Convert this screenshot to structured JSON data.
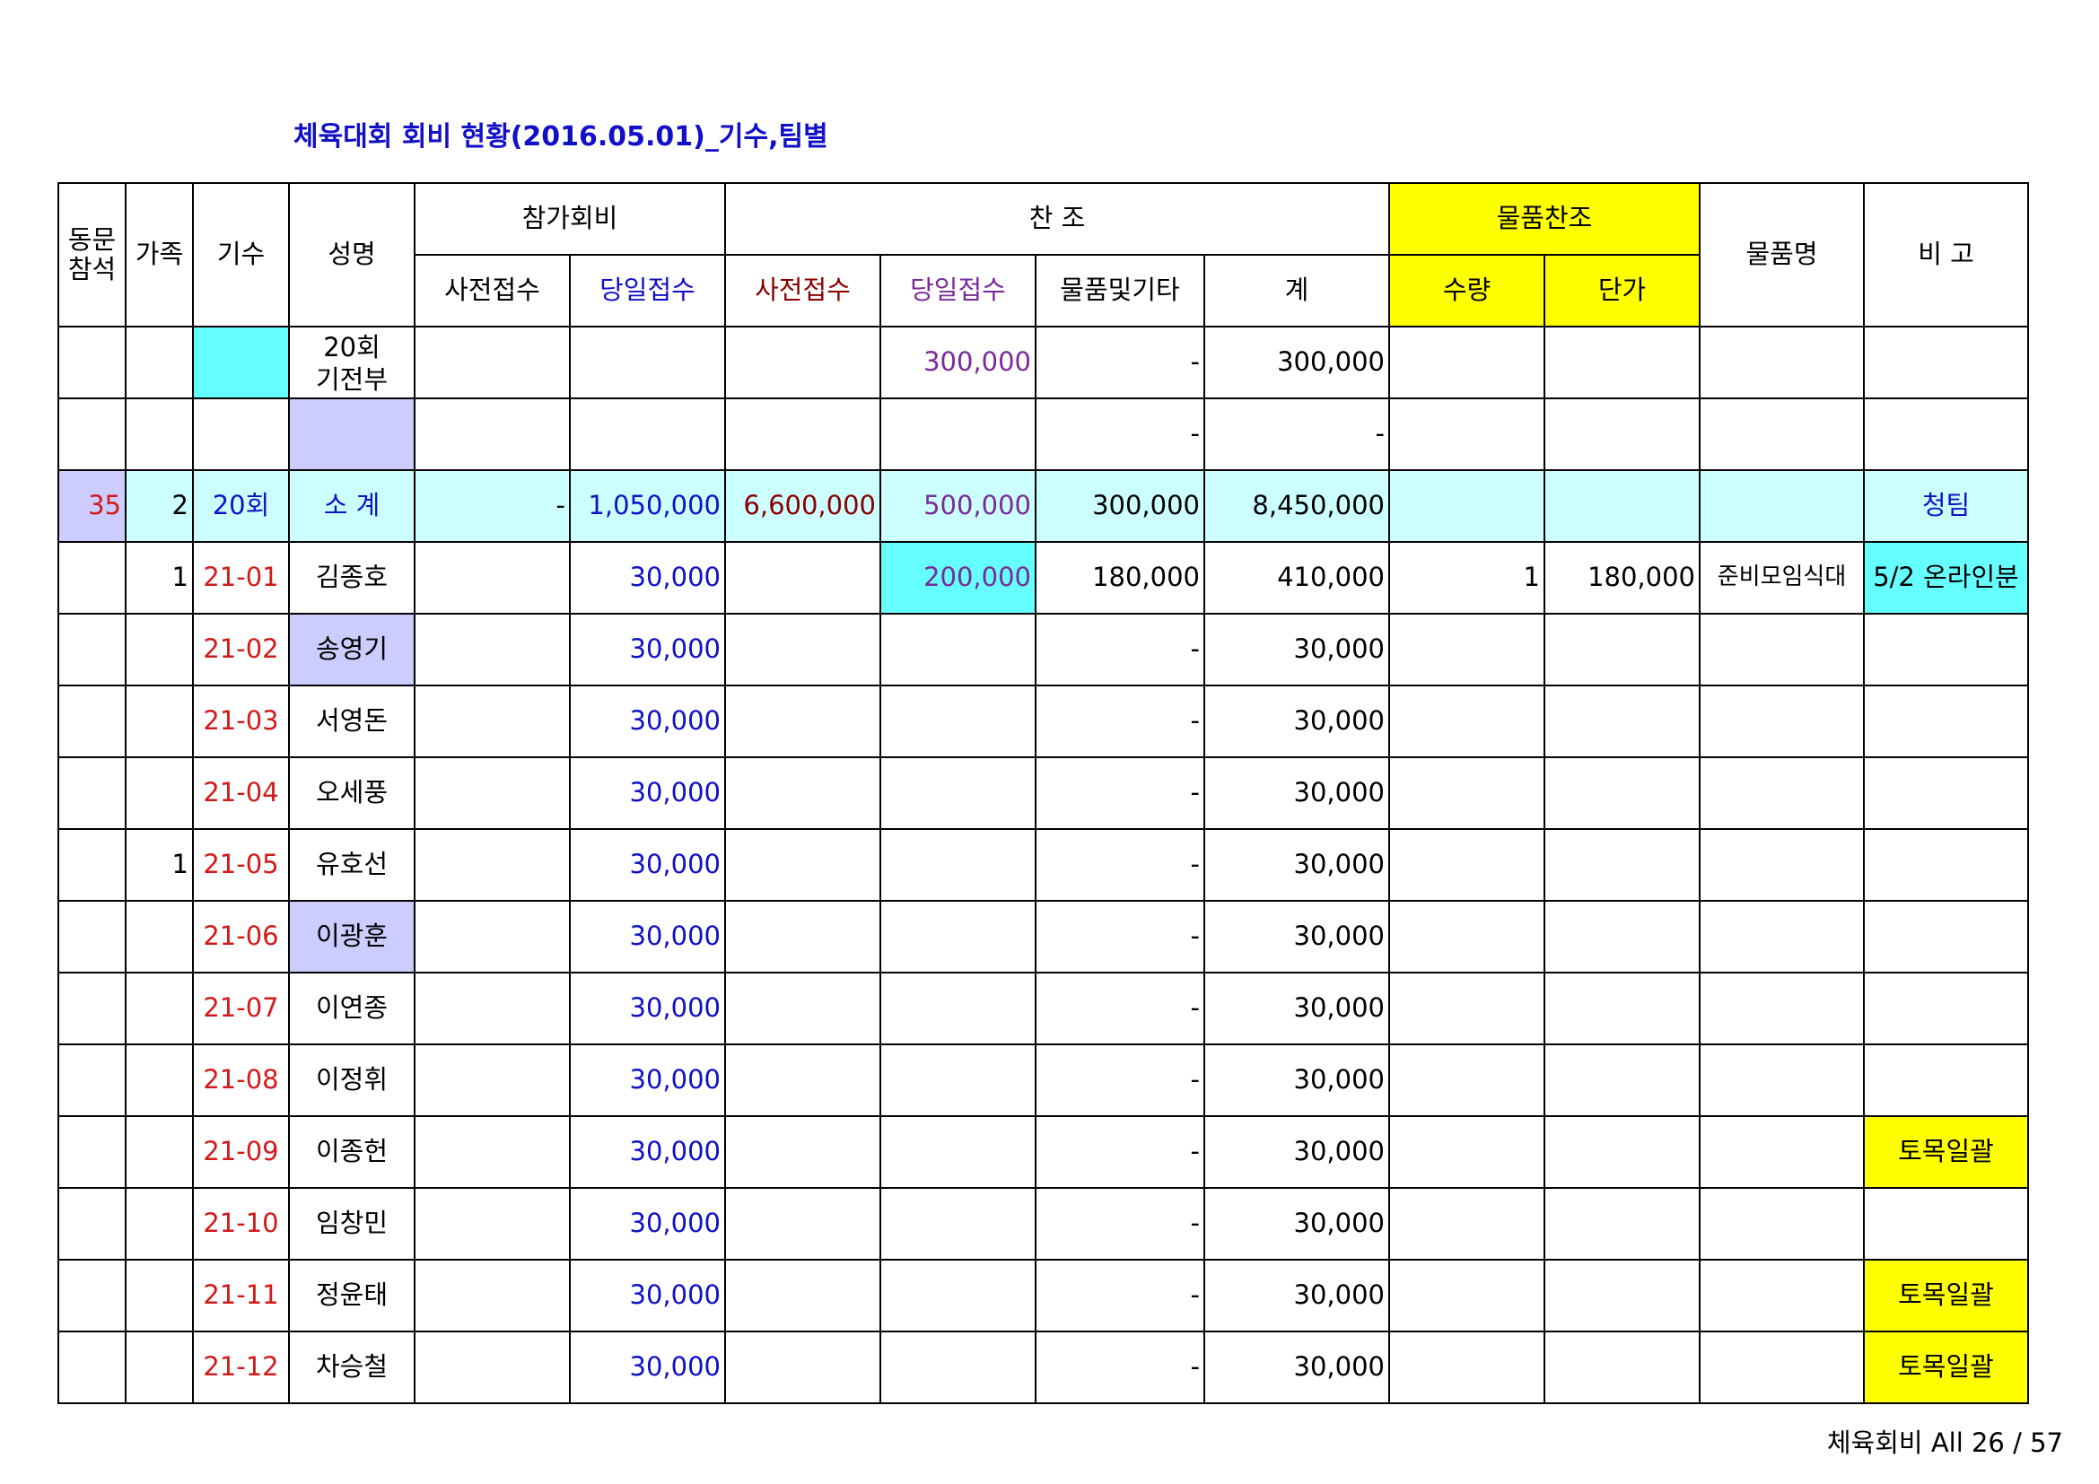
{
  "title": "체육대회 회비 현황(2016.05.01)_기수,팀별",
  "header": {
    "dongmun": "동문\n참석",
    "family": "가족",
    "gisu": "기수",
    "name": "성명",
    "fee_group": "참가회비",
    "sponsor_group": "찬 조",
    "goods_group": "물품찬조",
    "goods_name": "물품명",
    "remark": "비 고",
    "fee_pre": "사전접수",
    "fee_day": "당일접수",
    "sp_pre": "사전접수",
    "sp_day": "당일접수",
    "sp_goods": "물품및기타",
    "total": "계",
    "qty": "수량",
    "price": "단가"
  },
  "rows": [
    {
      "dongmun": "",
      "family": "",
      "gisu": "",
      "name": "20회\n기전부",
      "fee_pre": "",
      "fee_day": "",
      "sp_pre": "",
      "sp_day": "300,000",
      "sp_goods": "-",
      "total": "300,000",
      "qty": "",
      "price": "",
      "goods": "",
      "remark": ""
    },
    {
      "dongmun": "",
      "family": "",
      "gisu": "",
      "name": "",
      "fee_pre": "",
      "fee_day": "",
      "sp_pre": "",
      "sp_day": "",
      "sp_goods": "-",
      "total": "-",
      "qty": "",
      "price": "",
      "goods": "",
      "remark": ""
    },
    {
      "dongmun": "35",
      "family": "2",
      "gisu": "20회",
      "name": "소 계",
      "fee_pre": "-",
      "fee_day": "1,050,000",
      "sp_pre": "6,600,000",
      "sp_day": "500,000",
      "sp_goods": "300,000",
      "total": "8,450,000",
      "qty": "",
      "price": "",
      "goods": "",
      "remark": "청팀"
    },
    {
      "dongmun": "",
      "family": "1",
      "gisu": "21-01",
      "name": "김종호",
      "fee_pre": "",
      "fee_day": "30,000",
      "sp_pre": "",
      "sp_day": "200,000",
      "sp_goods": "180,000",
      "total": "410,000",
      "qty": "1",
      "price": "180,000",
      "goods": "준비모임식대",
      "remark": "5/2 온라인분"
    },
    {
      "dongmun": "",
      "family": "",
      "gisu": "21-02",
      "name": "송영기",
      "fee_pre": "",
      "fee_day": "30,000",
      "sp_pre": "",
      "sp_day": "",
      "sp_goods": "-",
      "total": "30,000",
      "qty": "",
      "price": "",
      "goods": "",
      "remark": ""
    },
    {
      "dongmun": "",
      "family": "",
      "gisu": "21-03",
      "name": "서영돈",
      "fee_pre": "",
      "fee_day": "30,000",
      "sp_pre": "",
      "sp_day": "",
      "sp_goods": "-",
      "total": "30,000",
      "qty": "",
      "price": "",
      "goods": "",
      "remark": ""
    },
    {
      "dongmun": "",
      "family": "",
      "gisu": "21-04",
      "name": "오세풍",
      "fee_pre": "",
      "fee_day": "30,000",
      "sp_pre": "",
      "sp_day": "",
      "sp_goods": "-",
      "total": "30,000",
      "qty": "",
      "price": "",
      "goods": "",
      "remark": ""
    },
    {
      "dongmun": "",
      "family": "1",
      "gisu": "21-05",
      "name": "유호선",
      "fee_pre": "",
      "fee_day": "30,000",
      "sp_pre": "",
      "sp_day": "",
      "sp_goods": "-",
      "total": "30,000",
      "qty": "",
      "price": "",
      "goods": "",
      "remark": ""
    },
    {
      "dongmun": "",
      "family": "",
      "gisu": "21-06",
      "name": "이광훈",
      "fee_pre": "",
      "fee_day": "30,000",
      "sp_pre": "",
      "sp_day": "",
      "sp_goods": "-",
      "total": "30,000",
      "qty": "",
      "price": "",
      "goods": "",
      "remark": ""
    },
    {
      "dongmun": "",
      "family": "",
      "gisu": "21-07",
      "name": "이연종",
      "fee_pre": "",
      "fee_day": "30,000",
      "sp_pre": "",
      "sp_day": "",
      "sp_goods": "-",
      "total": "30,000",
      "qty": "",
      "price": "",
      "goods": "",
      "remark": ""
    },
    {
      "dongmun": "",
      "family": "",
      "gisu": "21-08",
      "name": "이정휘",
      "fee_pre": "",
      "fee_day": "30,000",
      "sp_pre": "",
      "sp_day": "",
      "sp_goods": "-",
      "total": "30,000",
      "qty": "",
      "price": "",
      "goods": "",
      "remark": ""
    },
    {
      "dongmun": "",
      "family": "",
      "gisu": "21-09",
      "name": "이종헌",
      "fee_pre": "",
      "fee_day": "30,000",
      "sp_pre": "",
      "sp_day": "",
      "sp_goods": "-",
      "total": "30,000",
      "qty": "",
      "price": "",
      "goods": "",
      "remark": "토목일괄"
    },
    {
      "dongmun": "",
      "family": "",
      "gisu": "21-10",
      "name": "임창민",
      "fee_pre": "",
      "fee_day": "30,000",
      "sp_pre": "",
      "sp_day": "",
      "sp_goods": "-",
      "total": "30,000",
      "qty": "",
      "price": "",
      "goods": "",
      "remark": ""
    },
    {
      "dongmun": "",
      "family": "",
      "gisu": "21-11",
      "name": "정윤태",
      "fee_pre": "",
      "fee_day": "30,000",
      "sp_pre": "",
      "sp_day": "",
      "sp_goods": "-",
      "total": "30,000",
      "qty": "",
      "price": "",
      "goods": "",
      "remark": "토목일괄"
    },
    {
      "dongmun": "",
      "family": "",
      "gisu": "21-12",
      "name": "차승철",
      "fee_pre": "",
      "fee_day": "30,000",
      "sp_pre": "",
      "sp_day": "",
      "sp_goods": "-",
      "total": "30,000",
      "qty": "",
      "price": "",
      "goods": "",
      "remark": "토목일괄"
    }
  ],
  "footer": "체육회비 All 26 / 57",
  "colors": {
    "title": "#1010c8",
    "yellow": "#ffff00",
    "cyan": "#66ffff",
    "light_cyan": "#ccffff",
    "lavender": "#ccccff",
    "red": "#d21a1a",
    "dark_red": "#8b0000",
    "purple": "#7a2a9a",
    "blue": "#1010c8"
  }
}
